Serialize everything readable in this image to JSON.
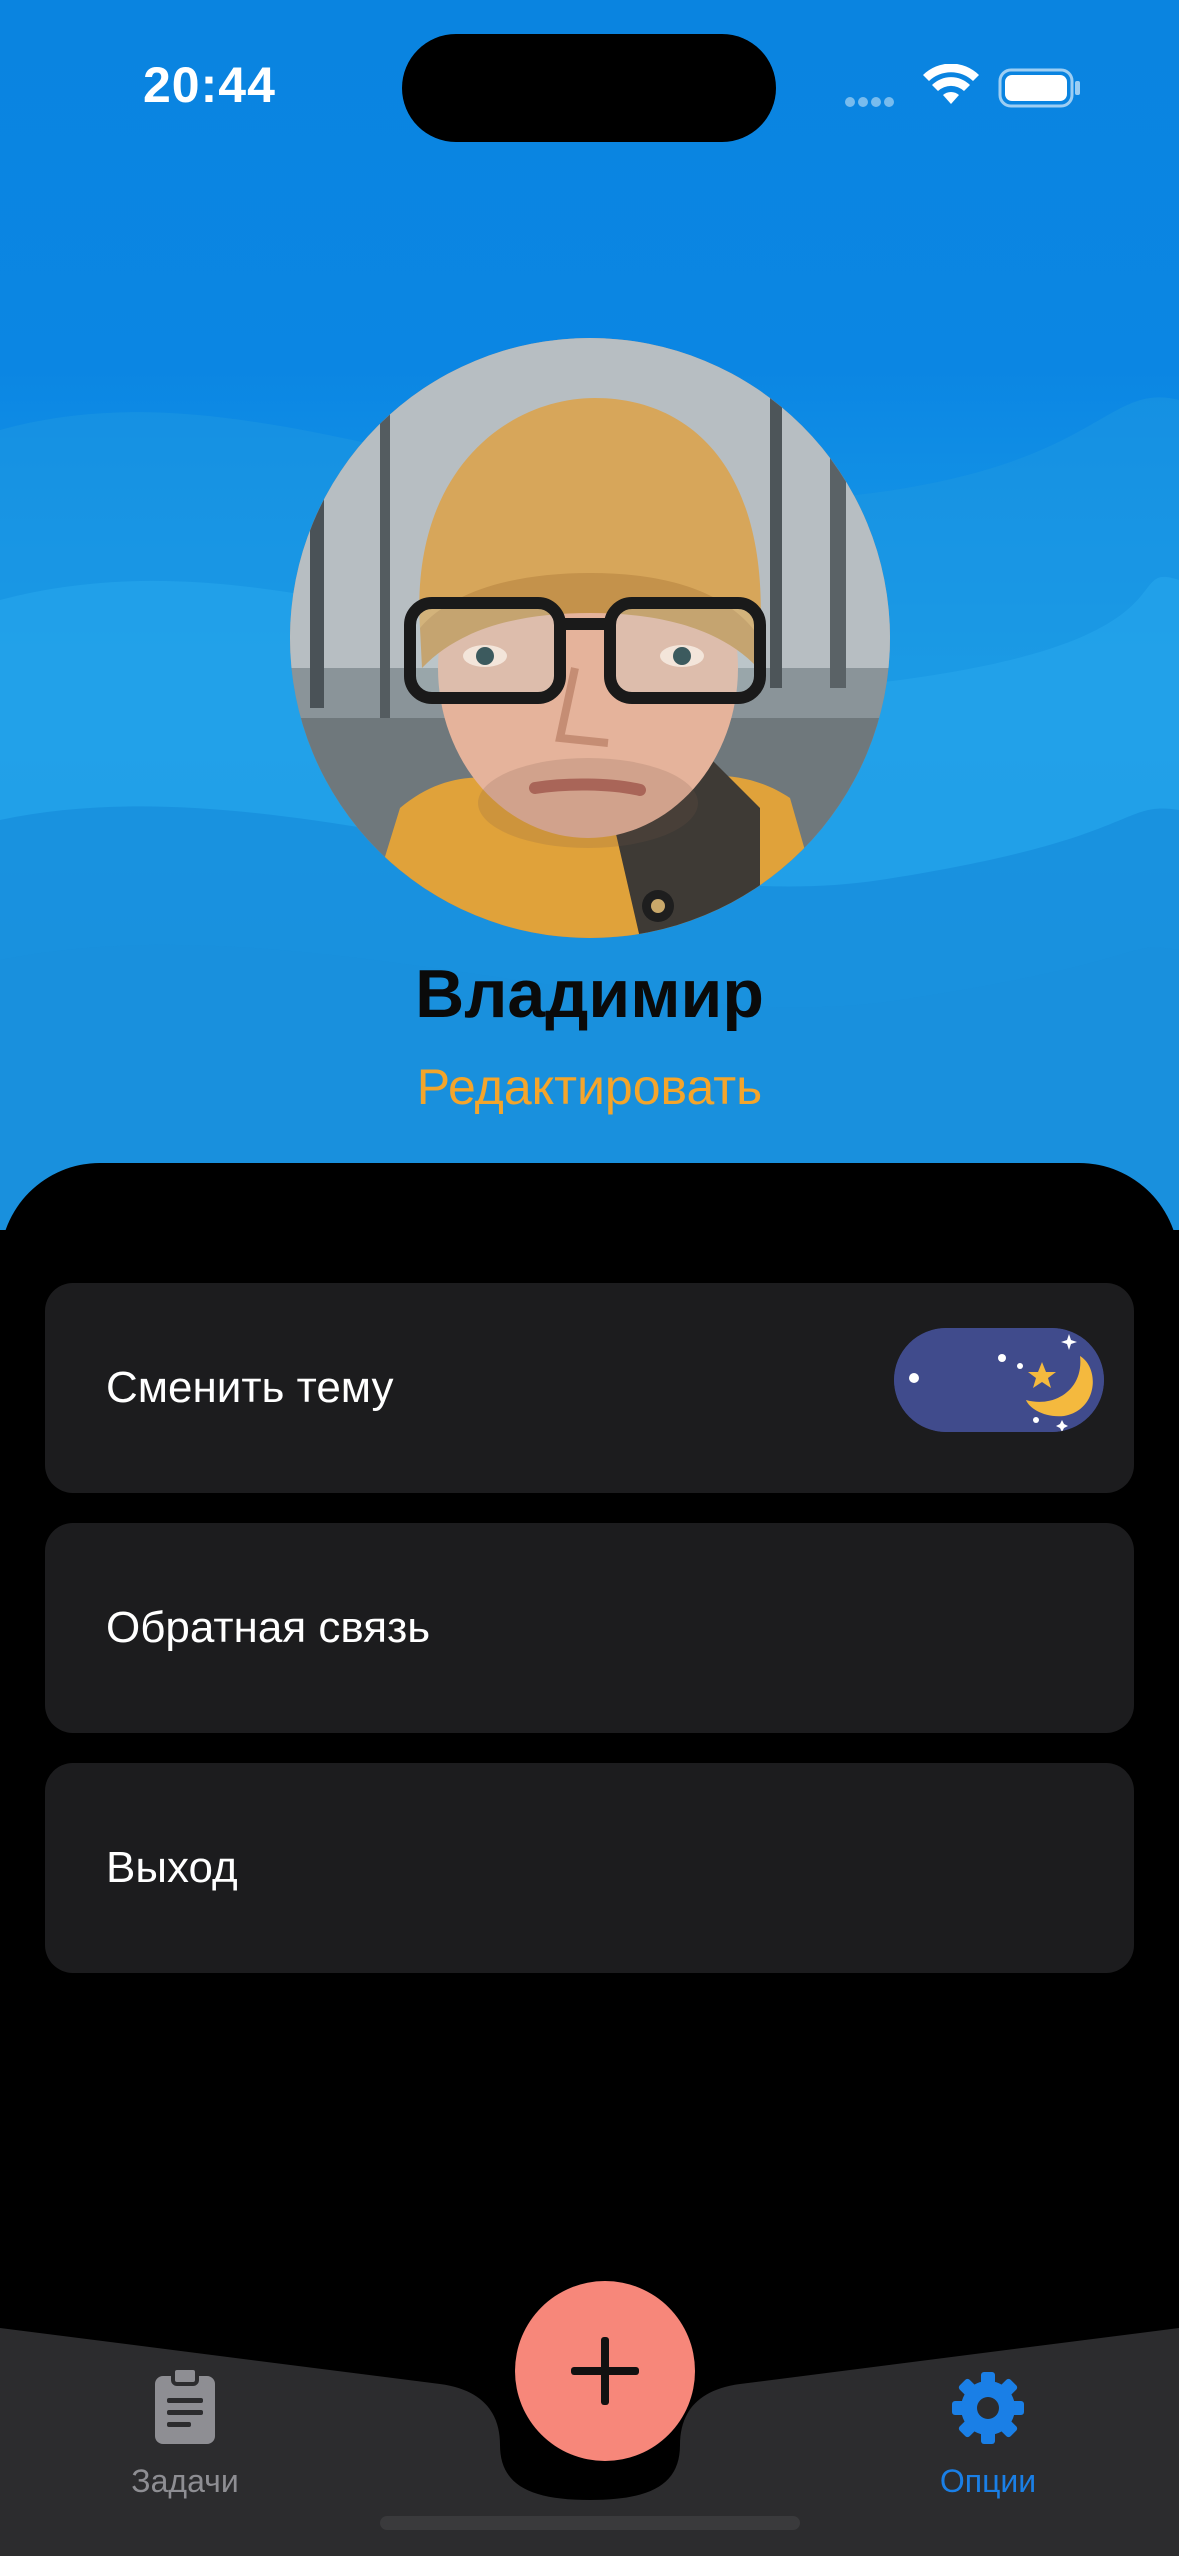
{
  "status_bar": {
    "time": "20:44"
  },
  "profile": {
    "name": "Владимир",
    "edit_label": "Редактировать"
  },
  "settings": {
    "items": [
      {
        "label": "Сменить тему"
      },
      {
        "label": "Обратная связь"
      },
      {
        "label": "Выход"
      }
    ],
    "theme_toggle_state": "dark"
  },
  "tabbar": {
    "tasks_label": "Задачи",
    "options_label": "Опции",
    "active_tab": "options"
  },
  "colors": {
    "accent_blue": "#1a7fe6",
    "edit_orange": "#f4a52b",
    "fab_salmon": "#f7877a",
    "row_background": "#1c1c1e"
  },
  "icons": {
    "tasks": "clipboard-icon",
    "options": "gear-icon",
    "fab": "plus-icon",
    "toggle": "moon-icon"
  }
}
